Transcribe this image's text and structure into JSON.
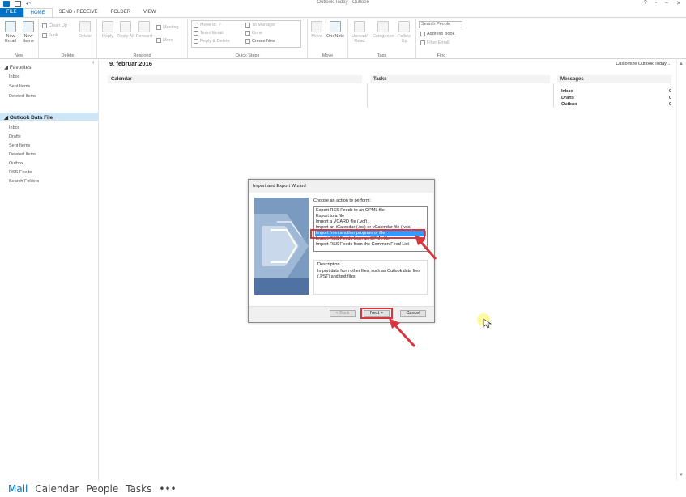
{
  "window": {
    "title": "Outlook Today - Outlook"
  },
  "tabs": [
    "FILE",
    "HOME",
    "SEND / RECEIVE",
    "FOLDER",
    "VIEW"
  ],
  "ribbon": {
    "groups": [
      "New",
      "Delete",
      "Respond",
      "Quick Steps",
      "Move",
      "Tags",
      "Find"
    ],
    "new_email": "New Email",
    "new_items": "New Items",
    "clean_up": "Clean Up",
    "junk": "Junk",
    "delete": "Delete",
    "reply": "Reply",
    "reply_all": "Reply All",
    "forward": "Forward",
    "meeting": "Meeting",
    "more": "More",
    "quick_steps": [
      "Move to: ?",
      "Team Email",
      "Reply & Delete",
      "To Manager",
      "Done",
      "Create New"
    ],
    "move": "Move",
    "onenote": "OneNote",
    "unread_read": "Unread/ Read",
    "categorize": "Categorize",
    "follow_up": "Follow Up",
    "search_people": "Search People",
    "address_book": "Address Book",
    "filter_email": "Filter Email"
  },
  "sidebar": {
    "favorites_label": "Favorites",
    "favorites": [
      "Inbox",
      "Sent Items",
      "Deleted Items"
    ],
    "data_file_label": "Outlook Data File",
    "data_file_items": [
      "Inbox",
      "Drafts",
      "Sent Items",
      "Deleted Items",
      "Outbox",
      "RSS Feeds",
      "Search Folders"
    ]
  },
  "main": {
    "date": "9. februar 2016",
    "customize": "Customize Outlook Today ...",
    "calendar": "Calendar",
    "tasks": "Tasks",
    "messages": "Messages",
    "message_rows": [
      {
        "name": "Inbox",
        "count": "0"
      },
      {
        "name": "Drafts",
        "count": "0"
      },
      {
        "name": "Outbox",
        "count": "0"
      }
    ]
  },
  "bottom_nav": [
    "Mail",
    "Calendar",
    "People",
    "Tasks",
    "•••"
  ],
  "dialog": {
    "title": "Import and Export Wizard",
    "prompt": "Choose an action to perform:",
    "options": [
      "Export RSS Feeds to an OPML file",
      "Export to a file",
      "Import a VCARD file (.vcf)",
      "Import an iCalendar (.ics) or vCalendar file (.vcs)",
      "Import from another program or file",
      "Import RSS Feeds from an OPML file",
      "Import RSS Feeds from the Common Feed List"
    ],
    "selected_index": 4,
    "description_label": "Description",
    "description_text": "Import data from other files, such as Outlook data files (.PST) and text files.",
    "back_button": "< Back",
    "next_button": "Next >",
    "cancel_button": "Cancel"
  },
  "colors": {
    "accent": "#0072c6",
    "highlight": "#d9373f",
    "selection": "#3399ff"
  }
}
